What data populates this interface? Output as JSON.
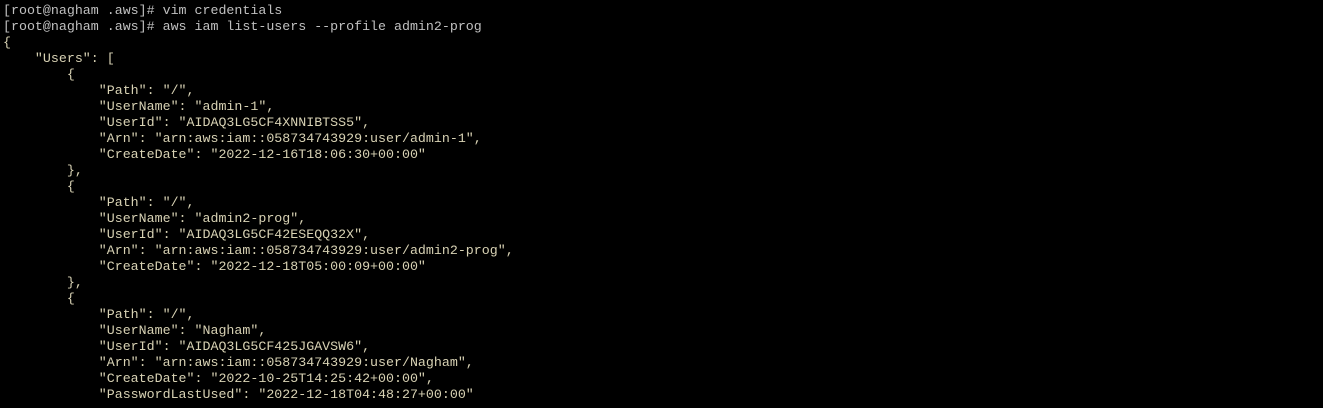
{
  "terminal": {
    "colors": {
      "background": "#000000",
      "prompt_text": "#c0c0c0",
      "output_text": "#d8d2b4"
    },
    "lines": [
      {
        "type": "prompt",
        "text": "[root@nagham .aws]# vim credentials"
      },
      {
        "type": "prompt",
        "text": "[root@nagham .aws]# aws iam list-users --profile admin2-prog"
      },
      {
        "type": "out",
        "text": "{"
      },
      {
        "type": "out",
        "text": "    \"Users\": ["
      },
      {
        "type": "out",
        "text": "        {"
      },
      {
        "type": "out",
        "text": "            \"Path\": \"/\","
      },
      {
        "type": "out",
        "text": "            \"UserName\": \"admin-1\","
      },
      {
        "type": "out",
        "text": "            \"UserId\": \"AIDAQ3LG5CF4XNNIBTSS5\","
      },
      {
        "type": "out",
        "text": "            \"Arn\": \"arn:aws:iam::058734743929:user/admin-1\","
      },
      {
        "type": "out",
        "text": "            \"CreateDate\": \"2022-12-16T18:06:30+00:00\""
      },
      {
        "type": "out",
        "text": "        },"
      },
      {
        "type": "out",
        "text": "        {"
      },
      {
        "type": "out",
        "text": "            \"Path\": \"/\","
      },
      {
        "type": "out",
        "text": "            \"UserName\": \"admin2-prog\","
      },
      {
        "type": "out",
        "text": "            \"UserId\": \"AIDAQ3LG5CF42ESEQQ32X\","
      },
      {
        "type": "out",
        "text": "            \"Arn\": \"arn:aws:iam::058734743929:user/admin2-prog\","
      },
      {
        "type": "out",
        "text": "            \"CreateDate\": \"2022-12-18T05:00:09+00:00\""
      },
      {
        "type": "out",
        "text": "        },"
      },
      {
        "type": "out",
        "text": "        {"
      },
      {
        "type": "out",
        "text": "            \"Path\": \"/\","
      },
      {
        "type": "out",
        "text": "            \"UserName\": \"Nagham\","
      },
      {
        "type": "out",
        "text": "            \"UserId\": \"AIDAQ3LG5CF425JGAVSW6\","
      },
      {
        "type": "out",
        "text": "            \"Arn\": \"arn:aws:iam::058734743929:user/Nagham\","
      },
      {
        "type": "out",
        "text": "            \"CreateDate\": \"2022-10-25T14:25:42+00:00\","
      },
      {
        "type": "out",
        "text": "            \"PasswordLastUsed\": \"2022-12-18T04:48:27+00:00\""
      }
    ]
  }
}
